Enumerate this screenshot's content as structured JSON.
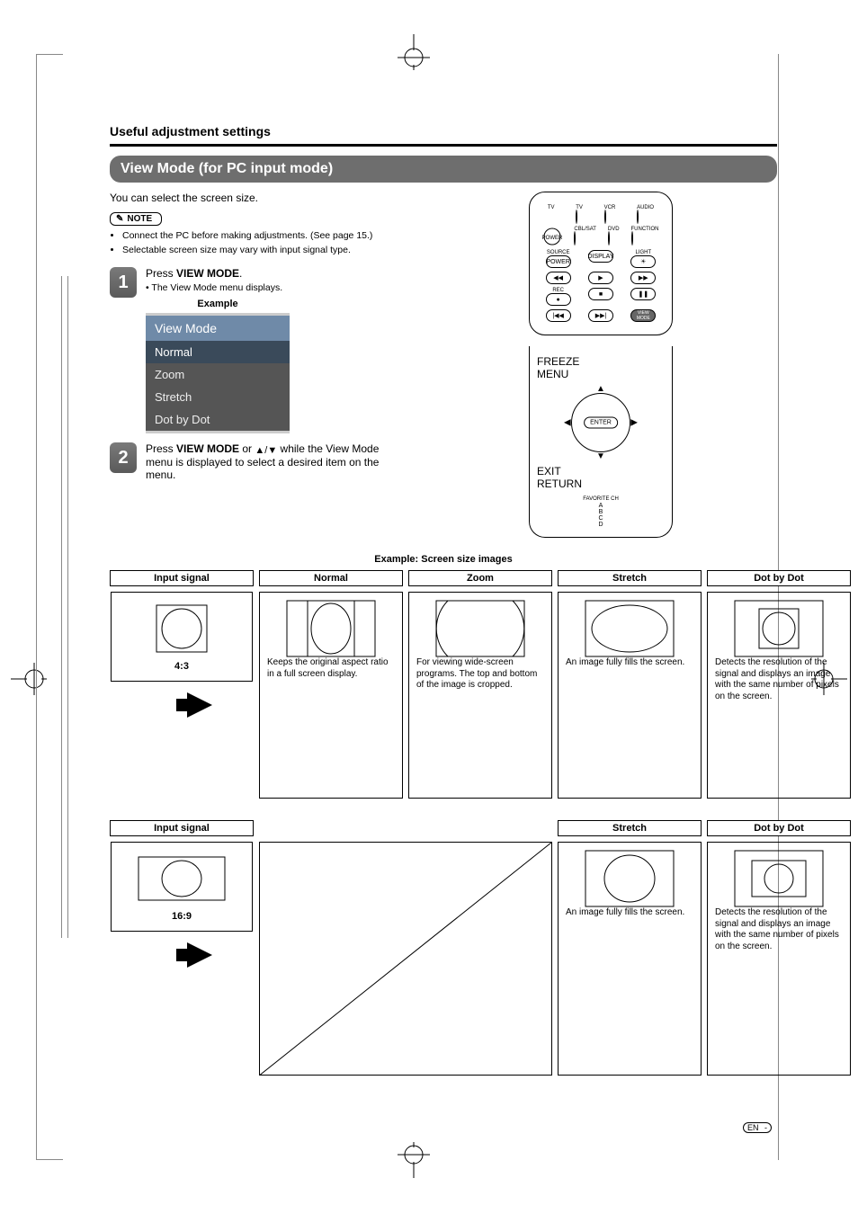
{
  "header": {
    "section_title": "Useful adjustment settings"
  },
  "banner": {
    "title": "View Mode (for PC input mode)"
  },
  "intro": "You can select the screen size.",
  "note": {
    "badge": "NOTE",
    "items": [
      "Connect the PC before making adjustments. (See page 15.)",
      "Selectable screen size may vary with input signal type."
    ]
  },
  "steps": [
    {
      "num": "1",
      "line_prefix": "Press ",
      "line_bold": "VIEW MODE",
      "line_suffix": ".",
      "sub": "The View Mode menu displays."
    },
    {
      "num": "2",
      "line_prefix": "Press ",
      "line_bold": "VIEW MODE",
      "line_mid": " or ",
      "line_arrows": "▲/▼",
      "line_suffix": " while the View Mode menu is displayed to select a desired item on the menu."
    }
  ],
  "menu_example": {
    "label": "Example",
    "title": "View Mode",
    "items": [
      "Normal",
      "Zoom",
      "Stretch",
      "Dot by Dot"
    ]
  },
  "remote": {
    "top_labels": [
      "TV",
      "TV",
      "VCR",
      "AUDIO"
    ],
    "mid_labels": [
      "CBL/SAT",
      "DVD",
      "FUNCTION"
    ],
    "source": "SOURCE",
    "power": "POWER",
    "display": "DISPLAY",
    "light": "LIGHT",
    "rec": "REC",
    "view_mode": "VIEW MODE",
    "freeze": "FREEZE",
    "menu": "MENU",
    "enter": "ENTER",
    "exit": "EXIT",
    "return": "RETURN",
    "fav": "FAVORITE CH",
    "fav_buttons": [
      "A",
      "B",
      "C",
      "D"
    ]
  },
  "screens": {
    "title": "Example: Screen size images",
    "col_input": "Input signal",
    "row43": {
      "label": "4:3",
      "normal": {
        "head": "Normal",
        "desc": "Keeps the original aspect ratio in a full screen display."
      },
      "zoom": {
        "head": "Zoom",
        "desc": "For viewing wide-screen programs. The top and bottom of the image is cropped."
      },
      "stretch": {
        "head": "Stretch",
        "desc": "An image fully fills the screen."
      },
      "dot": {
        "head": "Dot by Dot",
        "desc": "Detects the resolution of the signal and displays an image with the same number of pixels on the screen."
      }
    },
    "row169": {
      "label": "16:9",
      "stretch": {
        "head": "Stretch",
        "desc": "An image fully fills the screen."
      },
      "dot": {
        "head": "Dot by Dot",
        "desc": "Detects the resolution of the signal and displays an image with the same number of pixels on the screen."
      }
    }
  },
  "footer": {
    "lang": "EN"
  },
  "icons": {
    "note_pencil": "✎"
  }
}
